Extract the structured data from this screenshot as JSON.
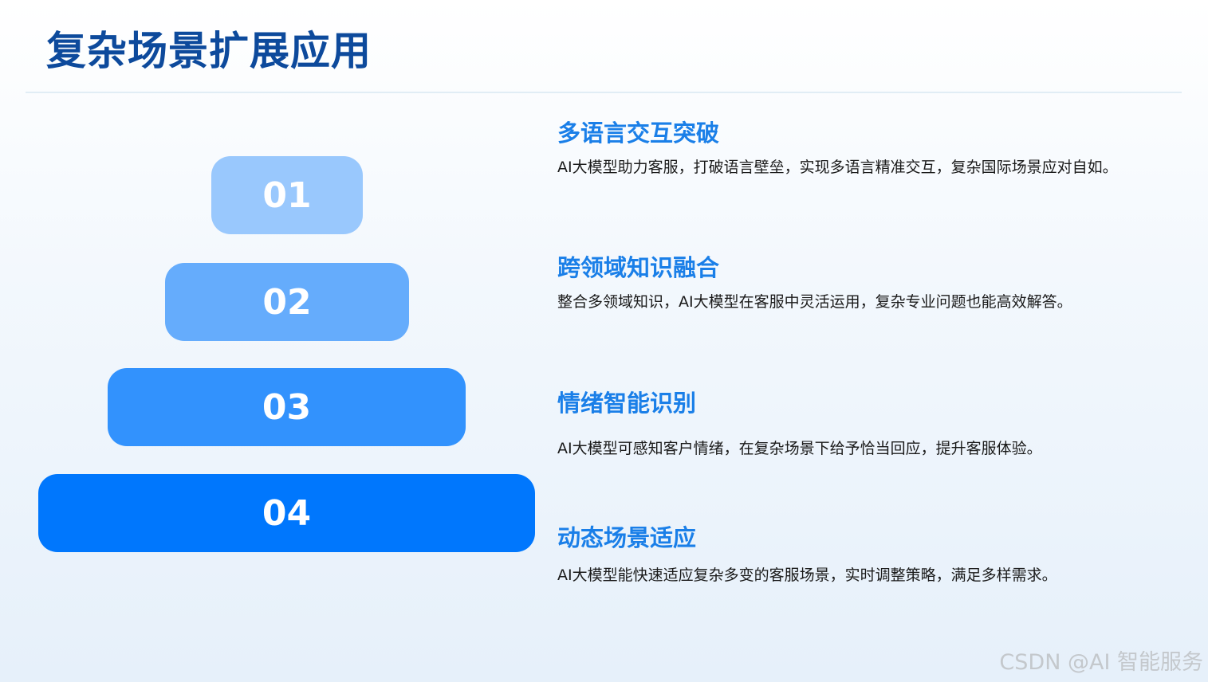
{
  "page": {
    "title": "复杂场景扩展应用"
  },
  "steps": [
    {
      "number": "01",
      "color": "#99c8fd"
    },
    {
      "number": "02",
      "color": "#65acfc"
    },
    {
      "number": "03",
      "color": "#3292fd"
    },
    {
      "number": "04",
      "color": "#0077fd"
    }
  ],
  "items": [
    {
      "title": "多语言交互突破",
      "description": "AI大模型助力客服，打破语言壁垒，实现多语言精准交互，复杂国际场景应对自如。"
    },
    {
      "title": "跨领域知识融合",
      "description": "整合多领域知识，AI大模型在客服中灵活运用，复杂专业问题也能高效解答。"
    },
    {
      "title": "情绪智能识别",
      "description": "AI大模型可感知客户情绪，在复杂场景下给予恰当回应，提升客服体验。"
    },
    {
      "title": "动态场景适应",
      "description": "AI大模型能快速适应复杂多变的客服场景，实时调整策略，满足多样需求。"
    }
  ],
  "watermark": "CSDN @AI 智能服务",
  "colors": {
    "title": "#0d4a9c",
    "item_title": "#1a7fe8",
    "text": "#1a1a1a"
  }
}
